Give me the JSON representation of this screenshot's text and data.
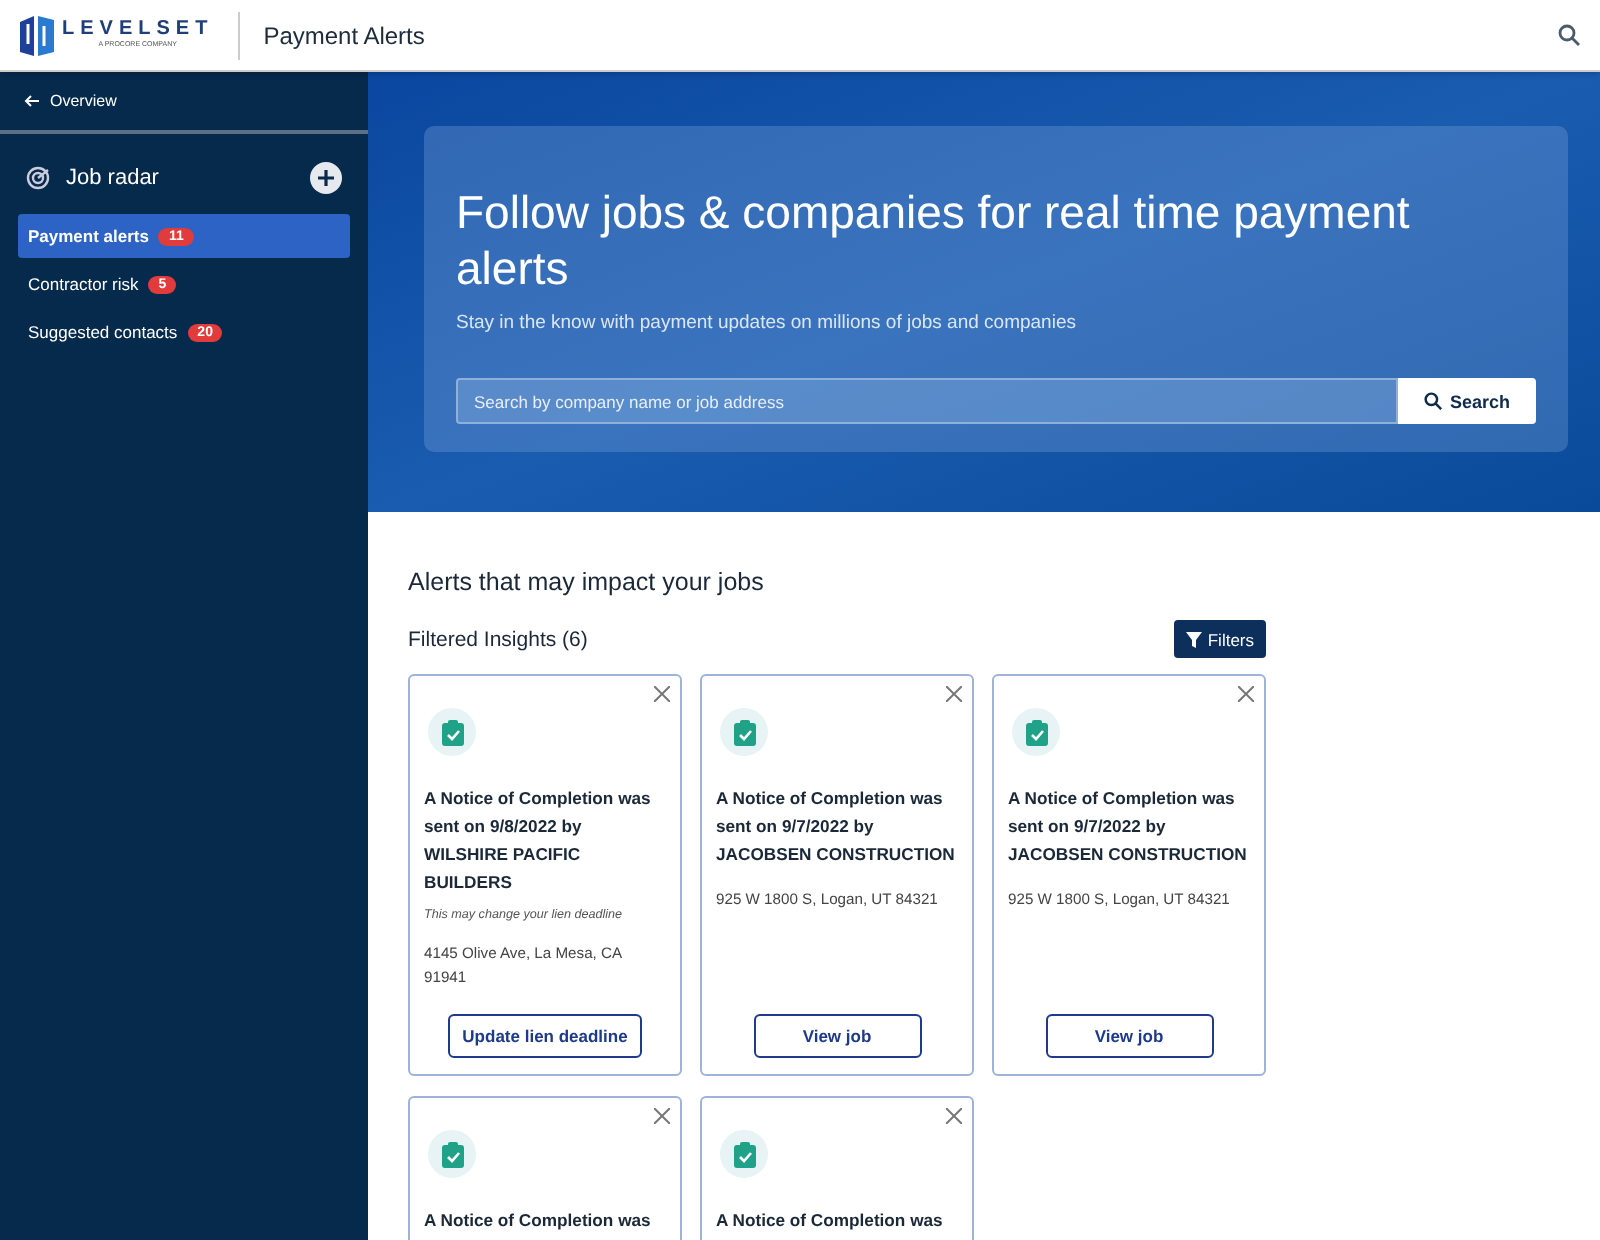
{
  "header": {
    "logo_name": "LEVELSET",
    "logo_tagline": "A PROCORE COMPANY",
    "title": "Payment Alerts"
  },
  "sidebar": {
    "back_link": "Overview",
    "section": {
      "title": "Job radar"
    },
    "items": [
      {
        "label": "Payment alerts",
        "count": "11",
        "selected": true
      },
      {
        "label": "Contractor risk",
        "count": "5",
        "selected": false
      },
      {
        "label": "Suggested contacts",
        "count": "20",
        "selected": false
      }
    ]
  },
  "hero": {
    "title": "Follow jobs & companies for real time payment alerts",
    "subtitle": "Stay in the know with payment updates on millions of jobs and companies",
    "search": {
      "placeholder": "Search by company name or job address",
      "button": "Search"
    }
  },
  "alerts": {
    "heading": "Alerts that may impact your jobs",
    "subheading": "Filtered Insights (6)",
    "filters_button": "Filters",
    "cards": [
      {
        "title": "A Notice of Completion was sent on 9/8/2022 by WILSHIRE PACIFIC BUILDERS",
        "note": "This may change your lien deadline",
        "address": "4145 Olive Ave, La Mesa, CA 91941",
        "button": "Update lien deadline"
      },
      {
        "title": "A Notice of Completion was sent on 9/7/2022 by JACOBSEN CONSTRUCTION",
        "address": "925 W 1800 S, Logan, UT 84321",
        "button": "View job"
      },
      {
        "title": "A Notice of Completion was sent on 9/7/2022 by JACOBSEN CONSTRUCTION",
        "address": "925 W 1800 S, Logan, UT 84321",
        "button": "View job"
      },
      {
        "title": "A Notice of Completion was"
      },
      {
        "title": "A Notice of Completion was"
      }
    ]
  }
}
